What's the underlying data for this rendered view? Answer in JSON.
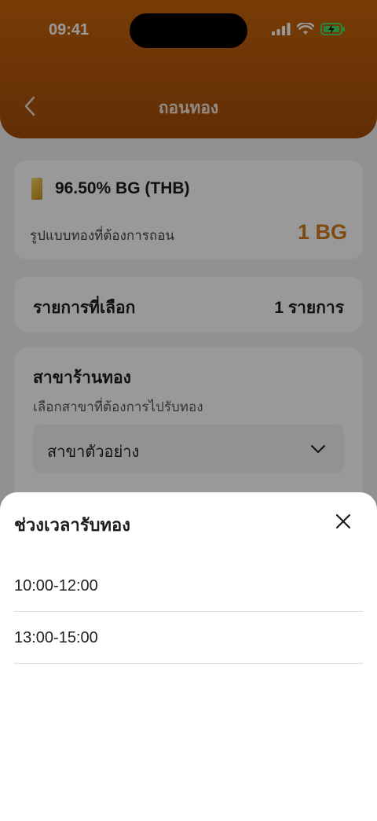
{
  "status_bar": {
    "time": "09:41"
  },
  "header": {
    "title": "ถอนทอง"
  },
  "product": {
    "name": "96.50% BG (THB)",
    "type_label": "รูปแบบทองที่ต้องการถอน",
    "amount": "1 BG",
    "icon": "gold-bar-icon"
  },
  "selected": {
    "label": "รายการที่เลือก",
    "value": "1 รายการ"
  },
  "branch": {
    "title": "สาขาร้านทอง",
    "subtitle": "เลือกสาขาที่ต้องการไปรับทอง",
    "selected_value": "สาขาตัวอย่าง"
  },
  "sheet": {
    "title": "ช่วงเวลารับทอง",
    "slots": [
      "10:00-12:00",
      "13:00-15:00"
    ]
  },
  "colors": {
    "header": "#c8650a",
    "accent_amount": "#d27c1c"
  }
}
